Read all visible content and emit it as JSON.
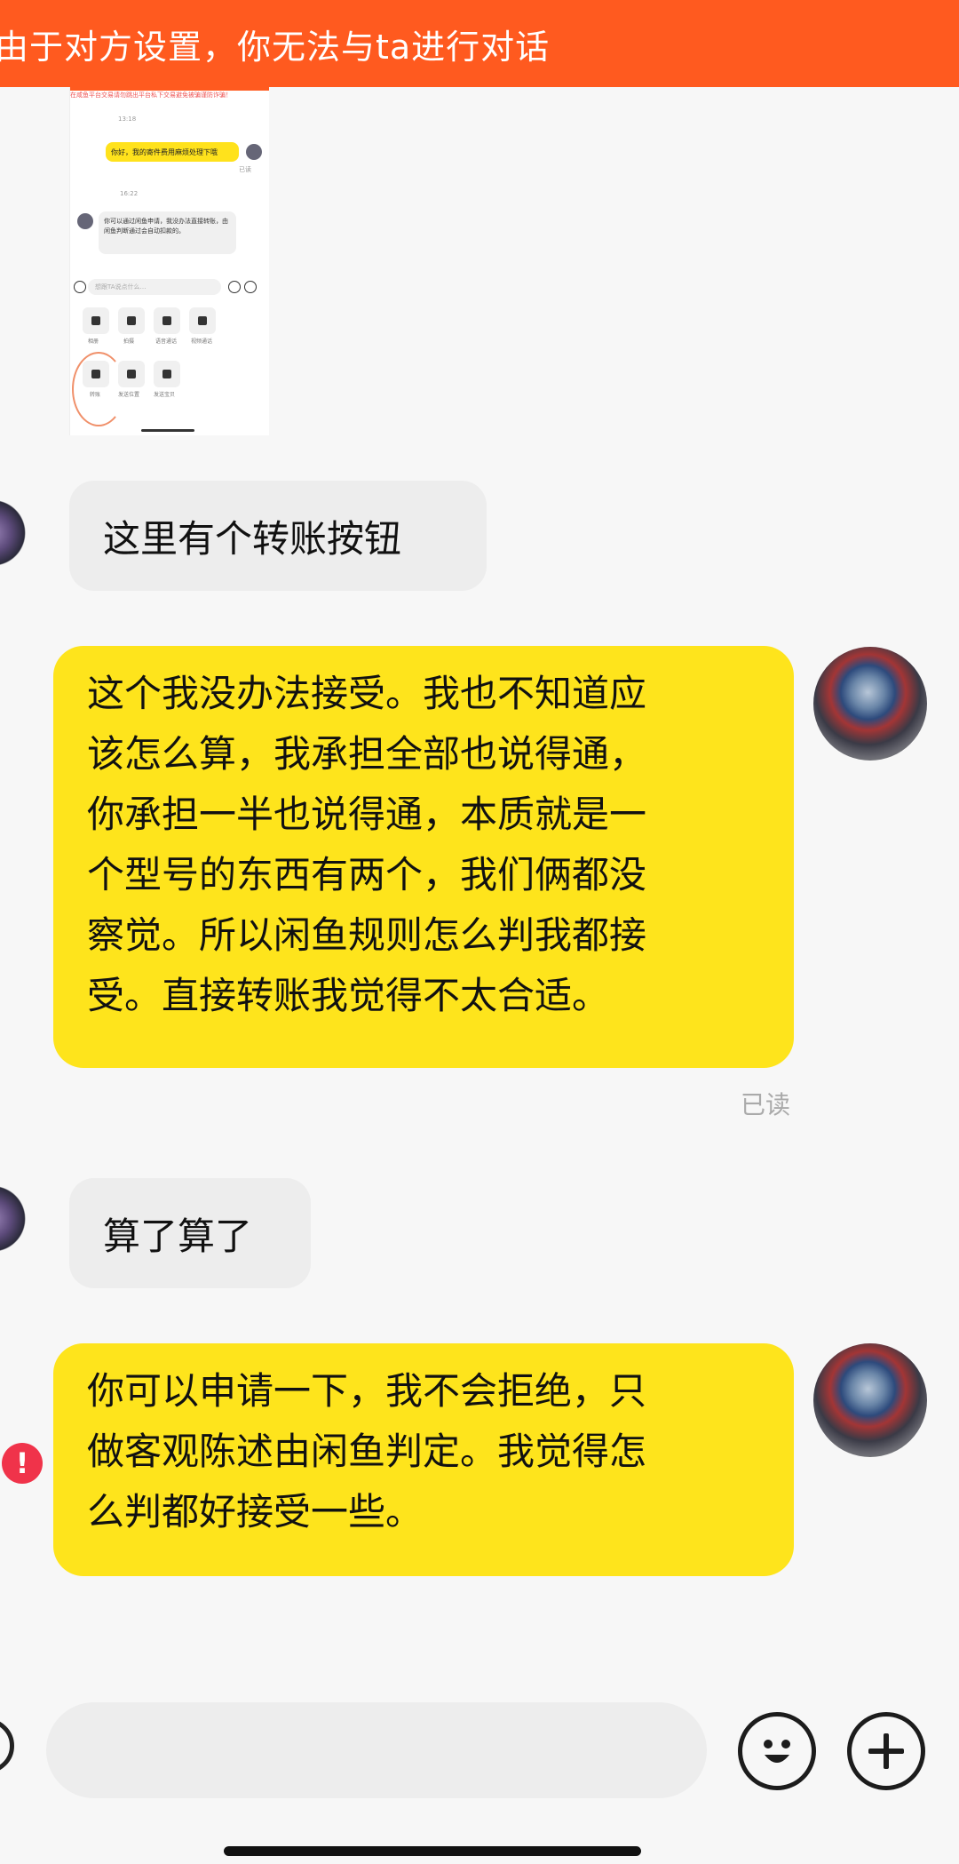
{
  "banner": {
    "text": "由于对方设置，你无法与ta进行对话"
  },
  "embedded_screenshot": {
    "notice": "在咸鱼平台交易请勿跳出平台私下交易避免被骗谨防诈骗！",
    "time_1": "13:18",
    "my_message": "你好，我的寄件费用麻烦处理下哦",
    "read_small": "已读",
    "time_2": "16:22",
    "other_message": "你可以通过闲鱼申请，我没办法直接转账，由闲鱼判断通过会自动扣款的。",
    "input_placeholder": "想跟TA说点什么…",
    "tools": [
      "相册",
      "拍摄",
      "语音通话",
      "视频通话",
      "转账",
      "发送位置",
      "发送宝贝"
    ]
  },
  "messages": [
    {
      "side": "left",
      "text": "这里有个转账按钮"
    },
    {
      "side": "right",
      "lines": [
        "这个我没办法接受。我也不知道应",
        "该怎么算，我承担全部也说得通，",
        "你承担一半也说得通，本质就是一",
        "个型号的东西有两个，我们俩都没",
        "察觉。所以闲鱼规则怎么判我都接",
        "受。直接转账我觉得不太合适。"
      ]
    },
    {
      "side": "left",
      "text": "算了算了"
    },
    {
      "side": "right",
      "lines": [
        "你可以申请一下，我不会拒绝，只",
        "做客观陈述由闲鱼判定。我觉得怎",
        "么判都好接受一些。"
      ]
    }
  ],
  "read_status": "已读",
  "error_mark": "!",
  "colors": {
    "banner": "#ff5a1f",
    "my_bubble": "#fee41c",
    "other_bubble": "#ededed",
    "error": "#f0334a"
  }
}
